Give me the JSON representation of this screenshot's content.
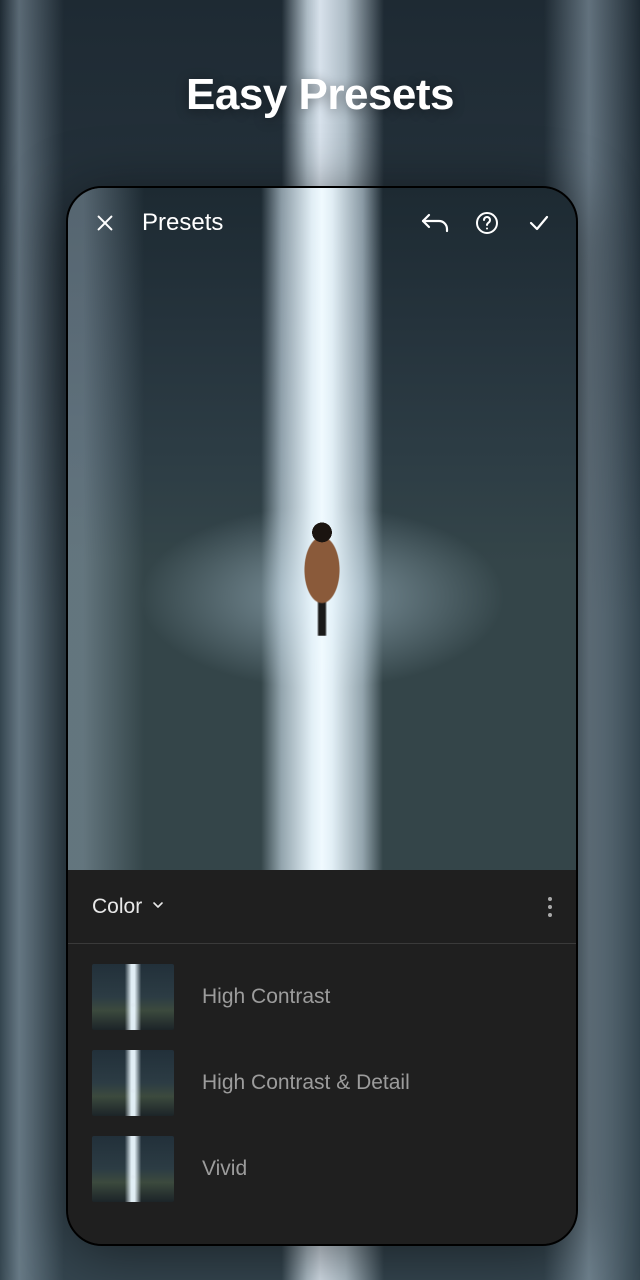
{
  "headline": "Easy Presets",
  "topbar": {
    "title": "Presets"
  },
  "panel": {
    "category": "Color"
  },
  "presets": [
    {
      "label": "High Contrast"
    },
    {
      "label": "High Contrast & Detail"
    },
    {
      "label": "Vivid"
    }
  ]
}
